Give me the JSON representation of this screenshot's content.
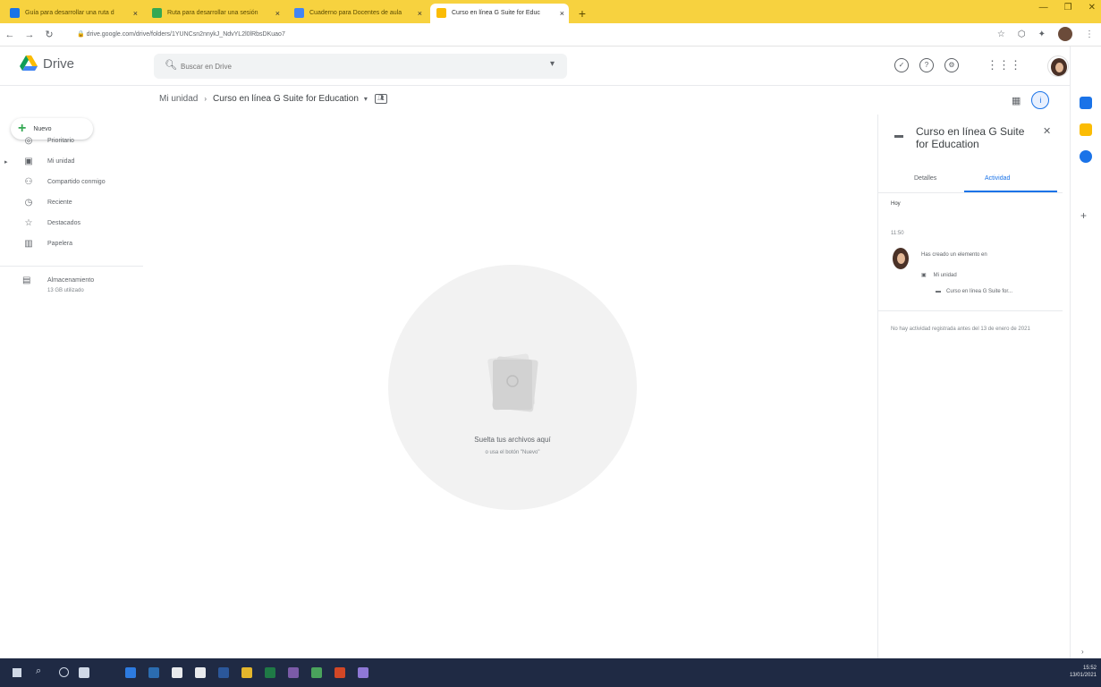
{
  "browser": {
    "tabs": [
      {
        "title": "Guía para desarrollar una ruta d",
        "favicon_color": "#1a73e8"
      },
      {
        "title": "Ruta para desarrollar una sesión",
        "favicon_color": "#34a853"
      },
      {
        "title": "Cuaderno para Docentes de aula",
        "favicon_color": "#4285f4"
      },
      {
        "title": "Curso en línea G Suite for Educ",
        "favicon_color": "#fbbc04",
        "active": true
      }
    ],
    "new_tab": "+",
    "url": "drive.google.com/drive/folders/1YUNCsn2nnykJ_NdvYL2l0lRbsDKuao7"
  },
  "drive": {
    "logo_text": "Drive",
    "search_placeholder": "Buscar en Drive",
    "new_button": "Nuevo",
    "nav_items": [
      {
        "label": "Prioritario",
        "icon": "priority-icon",
        "glyph": "◎",
        "has_arrow": false
      },
      {
        "label": "Mi unidad",
        "icon": "my-drive-icon",
        "glyph": "▣",
        "has_arrow": true
      },
      {
        "label": "Compartido conmigo",
        "icon": "shared-icon",
        "glyph": "⚇",
        "has_arrow": false
      },
      {
        "label": "Reciente",
        "icon": "recent-icon",
        "glyph": "◷",
        "has_arrow": false
      },
      {
        "label": "Destacados",
        "icon": "star-icon",
        "glyph": "☆",
        "has_arrow": false
      },
      {
        "label": "Papelera",
        "icon": "trash-icon",
        "glyph": "▥",
        "has_arrow": false
      }
    ],
    "storage": {
      "label": "Almacenamiento",
      "used": "13 GB utilizado"
    },
    "breadcrumb": {
      "root": "Mi unidad",
      "current": "Curso en línea G Suite for Education"
    },
    "empty": {
      "title": "Suelta tus archivos aquí",
      "subtitle": "o usa el botón \"Nuevo\""
    },
    "details": {
      "title": "Curso en línea G Suite for Education",
      "tabs": [
        "Detalles",
        "Actividad"
      ],
      "section": "Hoy",
      "date": "11:50",
      "activity_text": "Has creado un elemento en",
      "activity_folder": "Mi unidad",
      "activity_item": "Curso en línea G Suite for...",
      "note": "No hay actividad registrada antes del 13 de enero de 2021"
    }
  },
  "taskbar": {
    "time": "15:52",
    "date": "13/01/2021",
    "apps": [
      {
        "name": "task-view",
        "color": "#cfd8e6"
      },
      {
        "name": "edge",
        "color": "#2d7be0"
      },
      {
        "name": "file-explorer",
        "color": "#2b6cb0"
      },
      {
        "name": "store",
        "color": "#e8eaed"
      },
      {
        "name": "mail",
        "color": "#e8eaed"
      },
      {
        "name": "word",
        "color": "#2b579a"
      },
      {
        "name": "chrome",
        "color": "#e4b62c"
      },
      {
        "name": "excel",
        "color": "#1f7a46"
      },
      {
        "name": "photos",
        "color": "#7b5ba8"
      },
      {
        "name": "chrome-2",
        "color": "#4aa35c"
      },
      {
        "name": "powerpoint",
        "color": "#d24726"
      },
      {
        "name": "maps",
        "color": "#8e78d6"
      }
    ]
  },
  "colors": {
    "accent": "#1a73e8",
    "tabstrip": "#f7d23f",
    "taskbar": "#1f2a44"
  }
}
